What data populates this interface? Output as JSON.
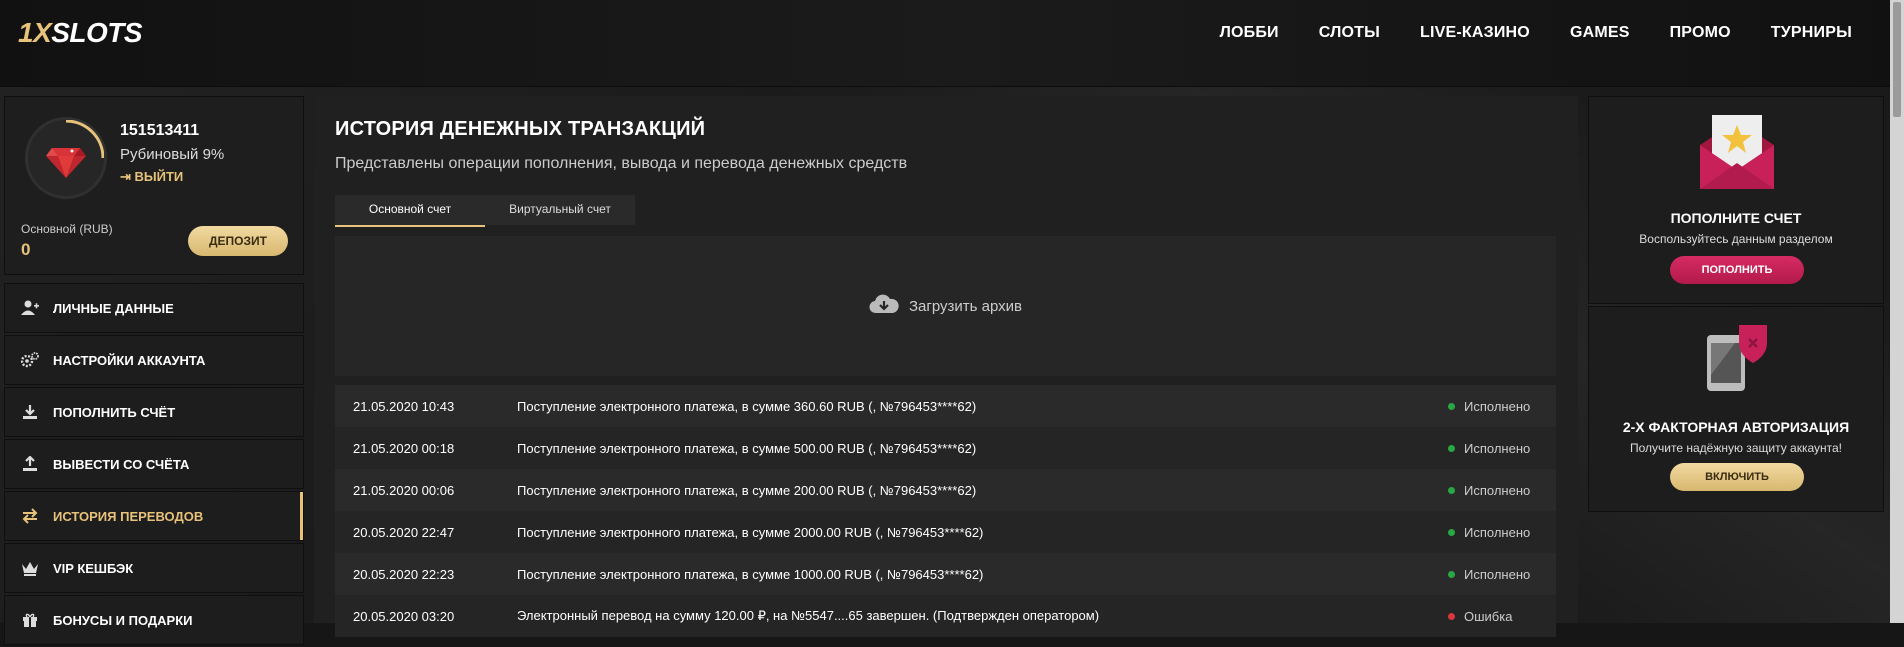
{
  "header": {
    "logo_part1": "1X",
    "logo_part2": "SLOTS",
    "nav": [
      "ЛОББИ",
      "СЛОТЫ",
      "LIVE-КАЗИНО",
      "GAMES",
      "ПРОМО",
      "ТУРНИРЫ"
    ]
  },
  "profile": {
    "user_id": "151513411",
    "rank": "Рубиновый 9%",
    "logout": "ВЫЙТИ",
    "balance_label": "Основной (RUB)",
    "balance_value": "0",
    "deposit_button": "ДЕПОЗИТ"
  },
  "menu": [
    {
      "label": "ЛИЧНЫЕ ДАННЫЕ",
      "icon": "user-plus-icon"
    },
    {
      "label": "НАСТРОЙКИ АККАУНТА",
      "icon": "gears-icon"
    },
    {
      "label": "ПОПОЛНИТЬ СЧЁТ",
      "icon": "download-icon"
    },
    {
      "label": "ВЫВЕСТИ СО СЧЁТА",
      "icon": "upload-icon"
    },
    {
      "label": "ИСТОРИЯ ПЕРЕВОДОВ",
      "icon": "exchange-icon",
      "active": true
    },
    {
      "label": "VIP КЕШБЭК",
      "icon": "crown-icon"
    },
    {
      "label": "БОНУСЫ И ПОДАРКИ",
      "icon": "gift-icon"
    }
  ],
  "main": {
    "title": "ИСТОРИЯ ДЕНЕЖНЫХ ТРАНЗАКЦИЙ",
    "subtitle": "Представлены операции пополнения, вывода и перевода денежных средств",
    "tabs": [
      "Основной счет",
      "Виртуальный счет"
    ],
    "archive_label": "Загрузить архив",
    "transactions": [
      {
        "date": "21.05.2020 10:43",
        "desc": "Поступление электронного платежа, в сумме 360.60 RUB (, №796453****62)",
        "status": "Исполнено",
        "status_color": "#27a844"
      },
      {
        "date": "21.05.2020 00:18",
        "desc": "Поступление электронного платежа, в сумме 500.00 RUB (, №796453****62)",
        "status": "Исполнено",
        "status_color": "#27a844"
      },
      {
        "date": "21.05.2020 00:06",
        "desc": "Поступление электронного платежа, в сумме 200.00 RUB (, №796453****62)",
        "status": "Исполнено",
        "status_color": "#27a844"
      },
      {
        "date": "20.05.2020 22:47",
        "desc": "Поступление электронного платежа, в сумме 2000.00 RUB (, №796453****62)",
        "status": "Исполнено",
        "status_color": "#27a844"
      },
      {
        "date": "20.05.2020 22:23",
        "desc": "Поступление электронного платежа, в сумме 1000.00 RUB (, №796453****62)",
        "status": "Исполнено",
        "status_color": "#27a844"
      },
      {
        "date": "20.05.2020 03:20",
        "desc": "Электронный перевод на сумму 120.00 ₽, на №5547....65 завершен. (Подтвержден оператором)",
        "status": "Ошибка",
        "status_color": "#d9363e"
      }
    ]
  },
  "cards": {
    "deposit": {
      "title": "ПОПОЛНИТЕ СЧЕТ",
      "text": "Воспользуйтесь данным разделом",
      "button": "ПОПОЛНИТЬ"
    },
    "twofa": {
      "title": "2-Х ФАКТОРНАЯ АВТОРИЗАЦИЯ",
      "text": "Получите надёжную защиту аккаунта!",
      "button": "ВКЛЮЧИТЬ"
    }
  },
  "colors": {
    "accent_gold": "#e6c27a",
    "accent_pink": "#c8215a",
    "success": "#27a844",
    "error": "#d9363e"
  }
}
